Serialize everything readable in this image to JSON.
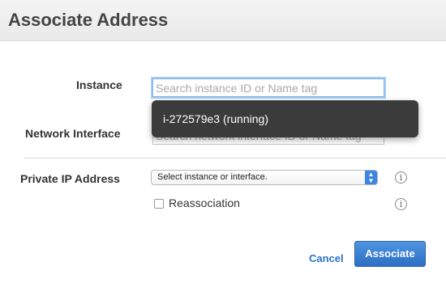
{
  "dialog": {
    "title": "Associate Address"
  },
  "form": {
    "instance": {
      "label": "Instance",
      "placeholder": "Search instance ID or Name tag"
    },
    "network_interface": {
      "label": "Network Interface",
      "placeholder": "Search network interface ID or Name tag"
    },
    "private_ip": {
      "label": "Private IP Address",
      "selected": "Select instance or interface."
    },
    "reassociation": {
      "label": "Reassociation",
      "checked": false
    }
  },
  "dropdown": {
    "items": [
      "i-272579e3 (running)"
    ]
  },
  "icons": {
    "info": "info-icon",
    "select_arrow": "chevron-updown-icon"
  },
  "buttons": {
    "cancel": "Cancel",
    "associate": "Associate"
  },
  "colors": {
    "accent": "#2c6ec4",
    "link": "#2a74c9",
    "dropdown_bg": "#3b3b3b",
    "focus_ring": "#a9cdf2"
  }
}
